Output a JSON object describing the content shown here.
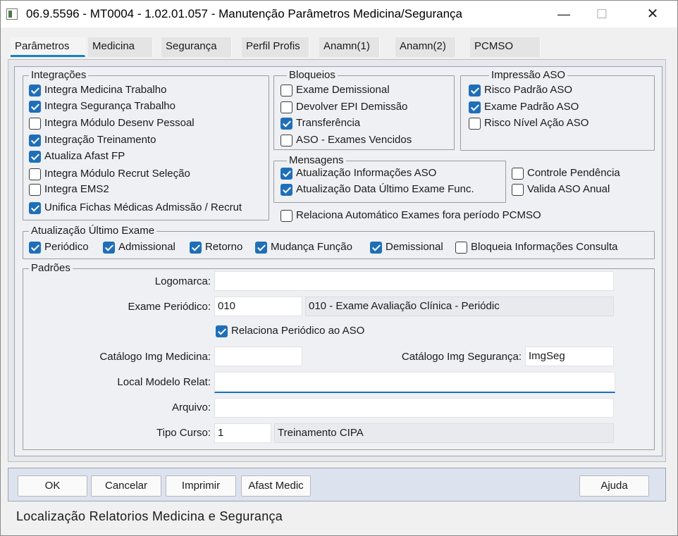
{
  "window": {
    "title": "06.9.5596 - MT0004 - 1.02.01.057 - Manutenção Parâmetros Medicina/Segurança",
    "min_glyph": "—",
    "max_glyph": "☐",
    "close_glyph": "✕"
  },
  "tabs": [
    {
      "label": "Parâmetros"
    },
    {
      "label": "Medicina"
    },
    {
      "label": "Segurança"
    },
    {
      "label": "Perfil Profis"
    },
    {
      "label": "Anamn(1)"
    },
    {
      "label": "Anamn(2)"
    },
    {
      "label": "PCMSO"
    }
  ],
  "integracoes": {
    "title": "Integrações",
    "items": [
      {
        "label": "Integra Medicina Trabalho",
        "checked": true
      },
      {
        "label": "Integra Segurança Trabalho",
        "checked": true
      },
      {
        "label": "Integra Módulo Desenv Pessoal",
        "checked": false
      },
      {
        "label": "Integração Treinamento",
        "checked": true
      },
      {
        "label": "Atualiza Afast FP",
        "checked": true
      },
      {
        "label": "Integra Módulo Recrut Seleção",
        "checked": false
      },
      {
        "label": "Integra EMS2",
        "checked": false
      },
      {
        "label": "Unifica Fichas Médicas Admissão / Recrut",
        "checked": true
      }
    ]
  },
  "bloqueios": {
    "title": "Bloqueios",
    "items": [
      {
        "label": "Exame Demissional",
        "checked": false
      },
      {
        "label": "Devolver EPI Demissão",
        "checked": false
      },
      {
        "label": "Transferência",
        "checked": true
      },
      {
        "label": "ASO - Exames Vencidos",
        "checked": false
      }
    ]
  },
  "impressao": {
    "title": "Impressão ASO",
    "items": [
      {
        "label": "Risco Padrão ASO",
        "checked": true
      },
      {
        "label": "Exame Padrão ASO",
        "checked": true
      },
      {
        "label": "Risco Nível Ação ASO",
        "checked": false
      }
    ]
  },
  "mensagens": {
    "title": "Mensagens",
    "items": [
      {
        "label": "Atualização Informações ASO",
        "checked": true
      },
      {
        "label": "Atualização Data Último Exame Func.",
        "checked": true
      }
    ]
  },
  "extra_checks": [
    {
      "label": "Controle Pendência",
      "checked": false
    },
    {
      "label": "Valida ASO Anual",
      "checked": false
    },
    {
      "label": "Relaciona Automático Exames fora período PCMSO",
      "checked": false
    }
  ],
  "atualizacao": {
    "title": "Atualização Último Exame",
    "items": [
      {
        "label": "Periódico",
        "checked": true
      },
      {
        "label": "Admissional",
        "checked": true
      },
      {
        "label": "Retorno",
        "checked": true
      },
      {
        "label": "Mudança Função",
        "checked": true
      },
      {
        "label": "Demissional",
        "checked": true
      },
      {
        "label": "Bloqueia Informações Consulta",
        "checked": false
      }
    ]
  },
  "padroes": {
    "title": "Padrões",
    "logomarca_label": "Logomarca:",
    "logomarca_value": "",
    "exame_label": "Exame Periódico:",
    "exame_code": "010",
    "exame_desc": "010 - Exame Avaliação Clínica - Periódic",
    "relaciona_label": "Relaciona Periódico ao ASO",
    "relaciona_checked": true,
    "catalogo_med_label": "Catálogo Img Medicina:",
    "catalogo_med_value": "",
    "catalogo_seg_label": "Catálogo Img Segurança:",
    "catalogo_seg_value": "ImgSeg",
    "local_modelo_label": "Local Modelo Relat:",
    "local_modelo_value": "",
    "arquivo_label": "Arquivo:",
    "arquivo_value": "",
    "tipo_curso_label": "Tipo Curso:",
    "tipo_curso_code": "1",
    "tipo_curso_desc": "Treinamento CIPA"
  },
  "buttons": {
    "ok": "OK",
    "cancelar": "Cancelar",
    "imprimir": "Imprimir",
    "afast": "Afast Medic",
    "ajuda": "Ajuda"
  },
  "status": "Localização Relatorios Medicina e Segurança"
}
